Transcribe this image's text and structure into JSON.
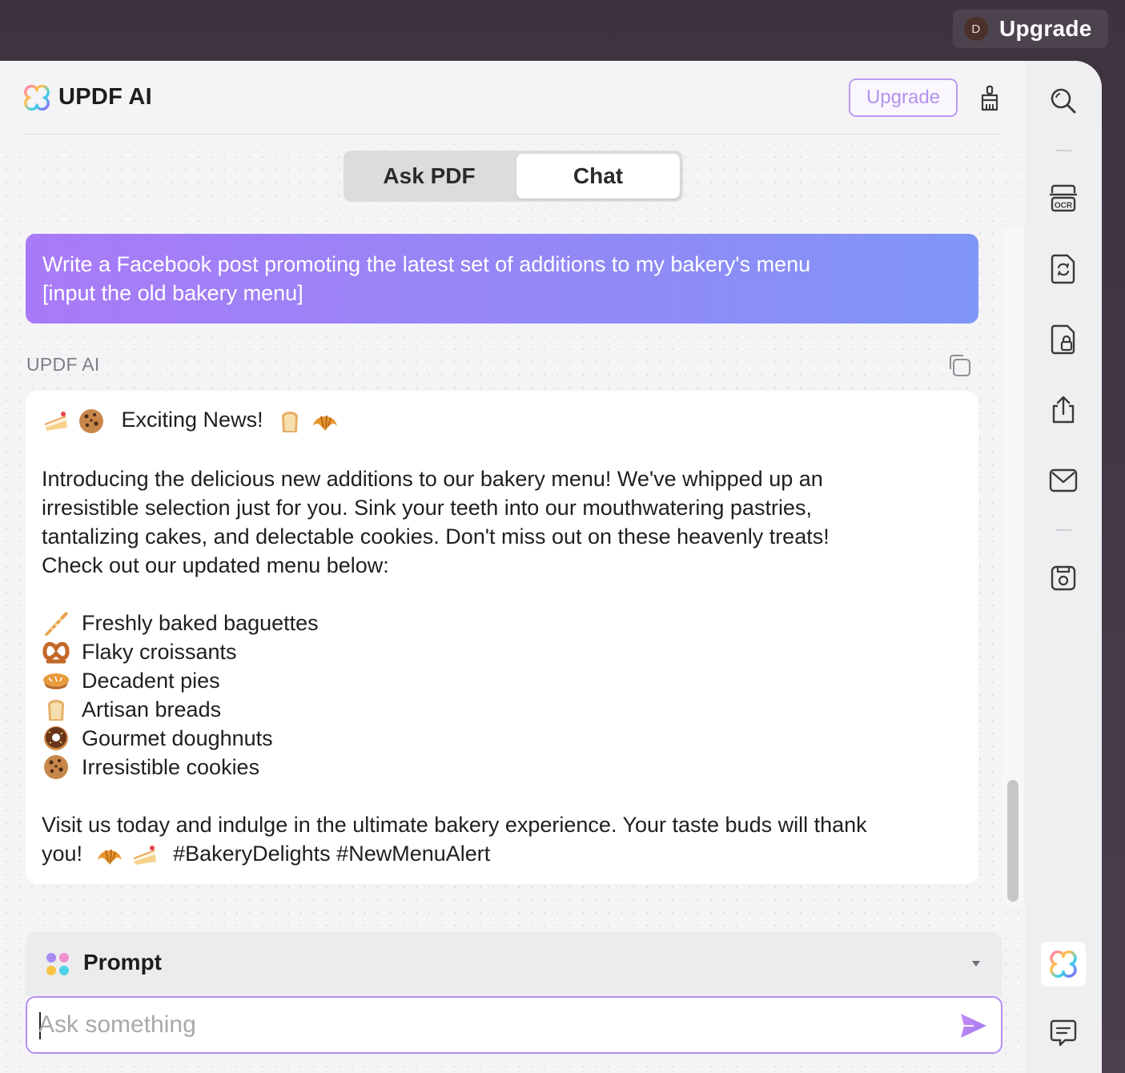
{
  "topbar": {
    "avatar_initial": "D",
    "upgrade_label": "Upgrade"
  },
  "header": {
    "title": "UPDF AI",
    "upgrade_label": "Upgrade"
  },
  "tabs": {
    "ask_pdf": "Ask PDF",
    "chat": "Chat",
    "active": "Chat"
  },
  "user_message": {
    "line1": "Write a Facebook post promoting the latest set of additions to my bakery's menu",
    "line2": "[input the old bakery menu]"
  },
  "ai_response": {
    "sender": "UPDF AI",
    "headline": "Exciting News!",
    "paragraph": [
      "Introducing the delicious new additions to our bakery menu! We've whipped up an",
      "irresistible selection just for you. Sink your teeth into our mouthwatering pastries,",
      "tantalizing cakes, and delectable cookies. Don't miss out on these heavenly treats!",
      "Check out our updated menu below:"
    ],
    "items": [
      {
        "icon": "baguette-emoji",
        "text": "Freshly baked baguettes"
      },
      {
        "icon": "pretzel-emoji",
        "text": "Flaky croissants"
      },
      {
        "icon": "pie-emoji",
        "text": "Decadent pies"
      },
      {
        "icon": "bread-emoji",
        "text": "Artisan breads"
      },
      {
        "icon": "doughnut-emoji",
        "text": "Gourmet doughnuts"
      },
      {
        "icon": "cookie-emoji",
        "text": "Irresistible cookies"
      }
    ],
    "closing_line1": "Visit us today and indulge in the ultimate bakery experience. Your taste buds will thank",
    "closing_line2_start": "you!",
    "hashtags": "#BakeryDelights #NewMenuAlert"
  },
  "prompt": {
    "label": "Prompt"
  },
  "input": {
    "placeholder": "Ask something",
    "value": ""
  },
  "toolbar": {
    "items": [
      "search-icon",
      "ocr-icon",
      "convert-icon",
      "protect-icon",
      "share-icon",
      "email-icon",
      "save-icon",
      "updf-ai-icon",
      "comment-icon"
    ],
    "active": "updf-ai-icon"
  },
  "colors": {
    "accent": "#a97af7",
    "accent_end": "#8097f7",
    "upgrade_border": "#b99cf0",
    "panel_bg": "#f4f4f6"
  }
}
